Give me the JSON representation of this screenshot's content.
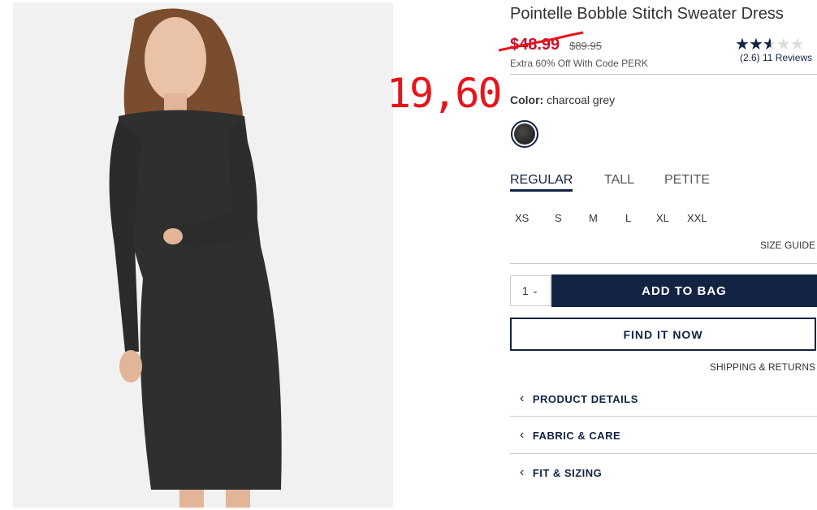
{
  "product": {
    "title": "Pointelle Bobble Stitch Sweater Dress",
    "sale_price": "$48.99",
    "original_price": "$89.95",
    "promo": "Extra 60% Off With Code PERK",
    "handwritten_price": "19,60",
    "rating": 2.6,
    "rating_text": "(2.6) 11 Reviews"
  },
  "color": {
    "label": "Color:",
    "value": "charcoal grey"
  },
  "fit_tabs": [
    {
      "label": "REGULAR",
      "active": true
    },
    {
      "label": "TALL",
      "active": false
    },
    {
      "label": "PETITE",
      "active": false
    }
  ],
  "sizes": [
    "XS",
    "S",
    "M",
    "L",
    "XL",
    "XXL"
  ],
  "size_guide": "SIZE GUIDE",
  "quantity": "1",
  "add_to_bag": "ADD TO BAG",
  "find_it_now": "FIND IT NOW",
  "shipping_returns": "SHIPPING & RETURNS",
  "accordion": [
    {
      "label": "PRODUCT DETAILS"
    },
    {
      "label": "FABRIC & CARE"
    },
    {
      "label": "FIT & SIZING"
    }
  ],
  "colors": {
    "brand_navy": "#122344",
    "sale_red": "#c8102e",
    "annotation_red": "#e8141b"
  },
  "icons": {
    "star": "star-icon",
    "chevron_down": "chevron-down-icon",
    "chevron_left": "chevron-left-icon"
  }
}
